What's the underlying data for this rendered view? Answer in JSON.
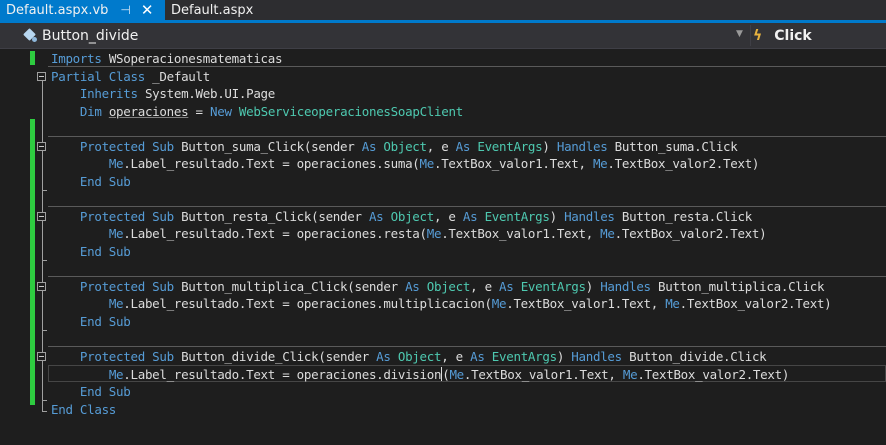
{
  "tabs": [
    {
      "label": "Default.aspx.vb",
      "active": true,
      "pin_glyph": "⊣",
      "close_glyph": "✕"
    },
    {
      "label": "Default.aspx",
      "active": false
    }
  ],
  "navbar": {
    "member_label": "Button_divide",
    "event_label": "Click"
  },
  "code": {
    "line1": {
      "kw": "Imports",
      "rest": " WSoperacionesmatematicas"
    },
    "line2": {
      "kw": "Partial Class",
      "rest": " _Default"
    },
    "line3": {
      "kw": "Inherits",
      "rest": " System.Web.UI.Page"
    },
    "line4": {
      "kw": "Dim",
      "name": "operaciones",
      "eq": " = ",
      "kw2": "New",
      "type": "WebServiceoperacionesSoapClient"
    },
    "suma": {
      "sig_kw": "Protected Sub",
      "name": " Button_suma_Click(sender ",
      "as1": "As",
      "obj": " Object",
      "mid": ", e ",
      "as2": "As",
      "ev": " EventArgs",
      "close": ") ",
      "handles": "Handles",
      "target": " Button_suma.Click",
      "me1": "Me",
      "body1": ".Label_resultado.Text = operaciones.suma(",
      "me2": "Me",
      "body2": ".TextBox_valor1.Text, ",
      "me3": "Me",
      "body3": ".TextBox_valor2.Text)",
      "end": "End Sub"
    },
    "resta": {
      "sig_kw": "Protected Sub",
      "name": " Button_resta_Click(sender ",
      "as1": "As",
      "obj": " Object",
      "mid": ", e ",
      "as2": "As",
      "ev": " EventArgs",
      "close": ") ",
      "handles": "Handles",
      "target": " Button_resta.Click",
      "me1": "Me",
      "body1": ".Label_resultado.Text = operaciones.resta(",
      "me2": "Me",
      "body2": ".TextBox_valor1.Text, ",
      "me3": "Me",
      "body3": ".TextBox_valor2.Text)",
      "end": "End Sub"
    },
    "multiplica": {
      "sig_kw": "Protected Sub",
      "name": " Button_multiplica_Click(sender ",
      "as1": "As",
      "obj": " Object",
      "mid": ", e ",
      "as2": "As",
      "ev": " EventArgs",
      "close": ") ",
      "handles": "Handles",
      "target": " Button_multiplica.Click",
      "me1": "Me",
      "body1": ".Label_resultado.Text = operaciones.multiplicacion(",
      "me2": "Me",
      "body2": ".TextBox_valor1.Text, ",
      "me3": "Me",
      "body3": ".TextBox_valor2.Text)",
      "end": "End Sub"
    },
    "divide": {
      "sig_kw": "Protected Sub",
      "name": " Button_divide_Click(sender ",
      "as1": "As",
      "obj": " Object",
      "mid": ", e ",
      "as2": "As",
      "ev": " EventArgs",
      "close": ") ",
      "handles": "Handles",
      "target": " Button_divide.Click",
      "me1": "Me",
      "body1a": ".Label_resultado.Text = operaciones.division",
      "body1b": "(",
      "me2": "Me",
      "body2": ".TextBox_valor1.Text, ",
      "me3": "Me",
      "body3": ".TextBox_valor2.Text)",
      "end": "End Sub"
    },
    "end_class": "End Class"
  },
  "colors": {
    "accent": "#007acc",
    "keyword": "#569cd6",
    "type": "#4ec9b0",
    "changed_bar": "#2ecc40"
  }
}
